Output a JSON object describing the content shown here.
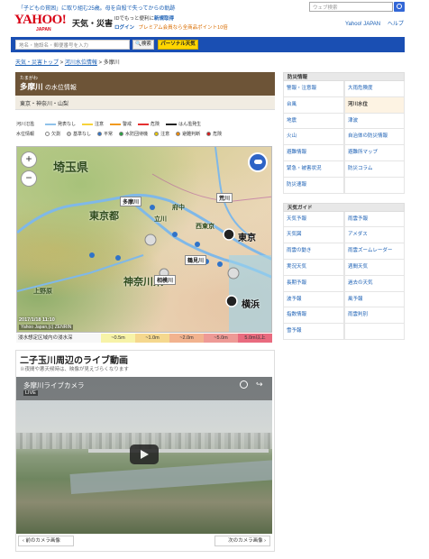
{
  "top": {
    "banner_link": "「子どもの貧困」に取り組む25歳。母を自殺で失ってからの軌跡",
    "logo": "YAHOO!",
    "logo_sub": "JAPAN",
    "service": "天気・災害",
    "promo_text": "IDでもっと便利に",
    "promo_link": "新規取得",
    "login": "ログイン",
    "premium": "プレミアム会員なら全商品ポイント10倍",
    "websearch_placeholder": "ウェブ検索",
    "yahoo_japan": "Yahoo! JAPAN",
    "help": "ヘルプ"
  },
  "searchbar": {
    "placeholder": "地名・施設名・郵便番号を入力",
    "search_label": "検索",
    "personal_label": "パーソナル天気"
  },
  "breadcrumb": [
    "天気・災害トップ",
    "河川水位情報",
    "多摩川"
  ],
  "main": {
    "ruby": "たまがわ",
    "title": "多摩川",
    "title_suffix": "の水位情報",
    "region": "東京・神奈川・山梨",
    "legend_river_label": "河川氾濫",
    "legend_river": [
      {
        "label": "発表なし",
        "color": "#8fc2ea"
      },
      {
        "label": "注意",
        "color": "#f7d23a"
      },
      {
        "label": "警戒",
        "color": "#f19a1f"
      },
      {
        "label": "危険",
        "color": "#e53030"
      },
      {
        "label": "はん濫発生",
        "color": "#222222"
      }
    ],
    "legend_level_label": "水位情報",
    "legend_level": [
      {
        "label": "欠測",
        "color": "#ffffff"
      },
      {
        "label": "基準なし",
        "color": "#cccccc"
      },
      {
        "label": "平常",
        "color": "#2f73c9"
      },
      {
        "label": "水防団待機",
        "color": "#27a040"
      },
      {
        "label": "注意",
        "color": "#e8c600"
      },
      {
        "label": "避難判断",
        "color": "#f08a00"
      },
      {
        "label": "危険",
        "color": "#d81818"
      }
    ],
    "map_labels": {
      "saitama": "埼玉県",
      "tokyo_metro": "東京都",
      "kanagawa": "神奈川県",
      "tokyo": "東京",
      "yokohama": "横浜",
      "tamagawa_river": "多摩川",
      "arakawa": "荒川",
      "tachikawa": "立川",
      "sagami": "相模川",
      "tsurumi": "鶴見川",
      "nishitokyo": "西東京",
      "fuchu": "府中",
      "ueno": "上野原"
    },
    "timestamp": "2017/1/18 11:10",
    "copyright": "Yahoo Japan,(c) ZENRIN",
    "flood_label": "浸水想定区域内の浸水深",
    "flood_bands": [
      {
        "label": "~0.5m",
        "color": "#f7f3a8"
      },
      {
        "label": "~1.0m",
        "color": "#f5d88e"
      },
      {
        "label": "~2.0m",
        "color": "#f2b38f"
      },
      {
        "label": "~5.0m",
        "color": "#ee9a96"
      },
      {
        "label": "5.0m以上",
        "color": "#e96b7f"
      }
    ]
  },
  "live": {
    "title": "二子玉川周辺のライブ動画",
    "note": "※夜間や悪天候時は、映像が見えづらくなります",
    "cam_name": "多摩川ライブカメラ",
    "live_badge": "LIVE",
    "prev": "前のカメラ画像",
    "next": "次のカメラ画像"
  },
  "sidebar": {
    "disaster_head": "防災情報",
    "disaster_items": [
      "警報・注意報",
      "大雨危険度",
      "台風",
      "河川水位",
      "地震",
      "津波",
      "火山",
      "自治体の防災情報",
      "避難情報",
      "避難所マップ",
      "緊急・被害状況",
      "防災コラム",
      "防災速報",
      ""
    ],
    "weather_head": "天気ガイド",
    "weather_items": [
      "天気予報",
      "雨雲予報",
      "天気図",
      "アメダス",
      "雨雲の動き",
      "雨雲ズームレーダー",
      "実況天気",
      "週間天気",
      "長期予報",
      "過去の天気",
      "波予報",
      "風予報",
      "指数情報",
      "雨雲判別",
      "雪予報",
      ""
    ],
    "active": "河川水位"
  }
}
